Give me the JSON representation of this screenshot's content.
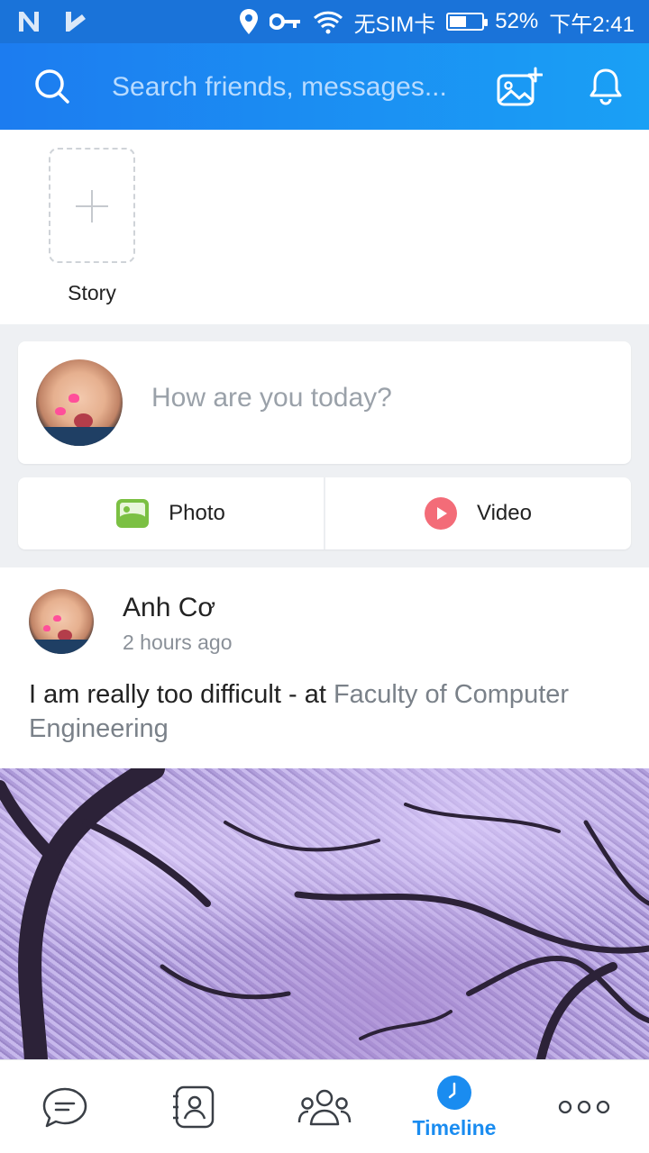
{
  "status_bar": {
    "sim": "无SIM卡",
    "battery": "52%",
    "time": "下午2:41",
    "battery_level": 0.52
  },
  "header": {
    "search_placeholder": "Search friends, messages..."
  },
  "story": {
    "label": "Story"
  },
  "compose": {
    "placeholder": "How are you today?"
  },
  "media": {
    "photo_label": "Photo",
    "video_label": "Video"
  },
  "post": {
    "author": "Anh Cơ",
    "time": "2 hours ago",
    "text": "I am really too difficult - at ",
    "place": "Faculty of Computer Engineering"
  },
  "bottom_nav": {
    "active": "Timeline",
    "accent": "#1a8cf0",
    "items": [
      "messages-icon",
      "contacts-icon",
      "groups-icon",
      "timeline-icon",
      "more-icon"
    ]
  },
  "colors": {
    "header_start": "#1c7cf0",
    "header_end": "#1aa0f5",
    "status_bar": "#1a73d9"
  }
}
